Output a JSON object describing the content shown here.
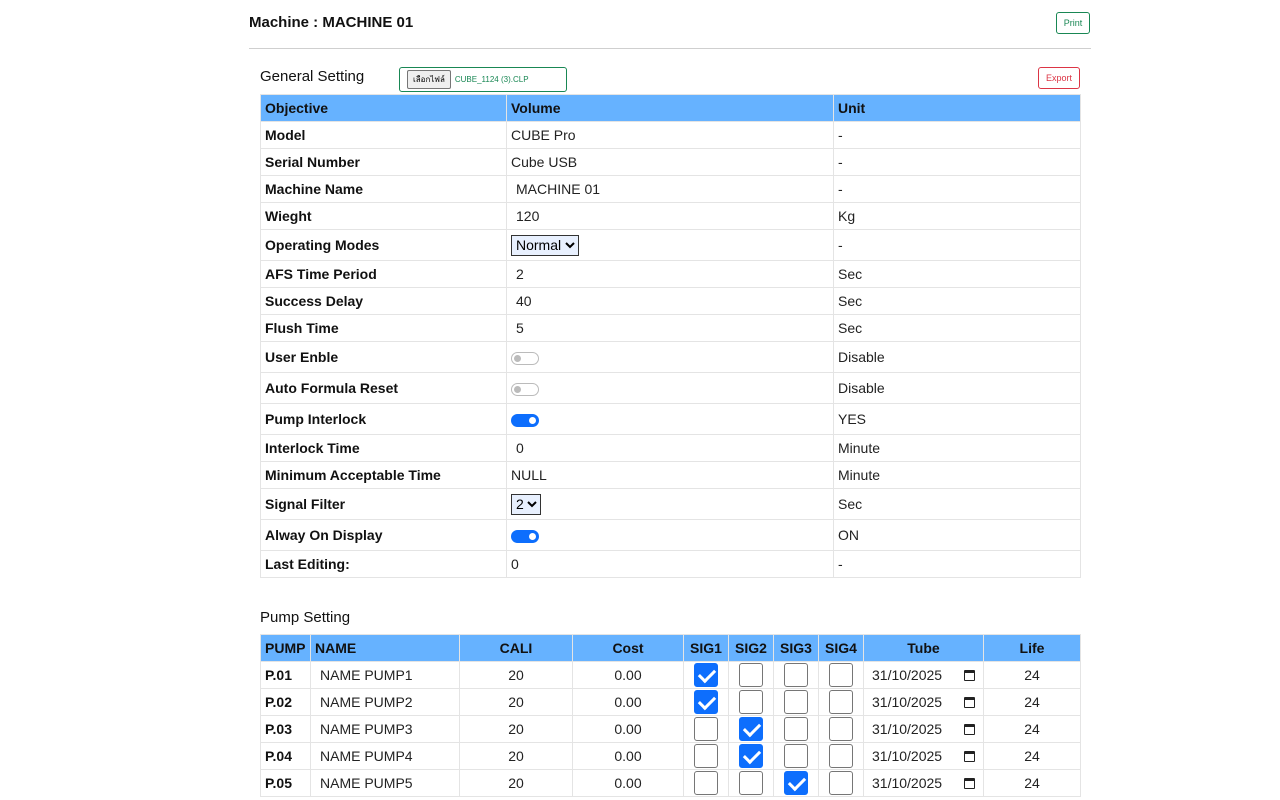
{
  "header": {
    "title": "Machine : MACHINE 01",
    "print_label": "Print"
  },
  "general": {
    "title": "General Setting",
    "file_button": "เลือกไฟล์",
    "file_name": "CUBE_1124 (3).CLP",
    "export_label": "Export",
    "columns": [
      "Objective",
      "Volume",
      "Unit"
    ],
    "rows": [
      {
        "label": "Model",
        "value": "CUBE Pro",
        "unit": "-"
      },
      {
        "label": "Serial Number",
        "value": "Cube USB",
        "unit": "-"
      },
      {
        "label": "Machine Name",
        "value": "MACHINE 01",
        "unit": "-"
      },
      {
        "label": "Wieght",
        "value": "120",
        "unit": "Kg"
      },
      {
        "label": "Operating Modes",
        "value": "Normal",
        "unit": "-"
      },
      {
        "label": "AFS Time Period",
        "value": "2",
        "unit": "Sec"
      },
      {
        "label": "Success Delay",
        "value": "40",
        "unit": "Sec"
      },
      {
        "label": "Flush Time",
        "value": "5",
        "unit": "Sec"
      },
      {
        "label": "User Enble",
        "value": false,
        "unit": "Disable"
      },
      {
        "label": "Auto Formula Reset",
        "value": false,
        "unit": "Disable"
      },
      {
        "label": "Pump Interlock",
        "value": true,
        "unit": "YES"
      },
      {
        "label": "Interlock Time",
        "value": "0",
        "unit": "Minute"
      },
      {
        "label": "Minimum Acceptable Time",
        "value": "NULL",
        "unit": "Minute"
      },
      {
        "label": "Signal Filter",
        "value": "2",
        "unit": "Sec"
      },
      {
        "label": "Alway On Display",
        "value": true,
        "unit": "ON"
      },
      {
        "label": "Last Editing:",
        "value": "0",
        "unit": "-"
      }
    ]
  },
  "pump": {
    "title": "Pump Setting",
    "columns": [
      "PUMP",
      "NAME",
      "CALI",
      "Cost",
      "SIG1",
      "SIG2",
      "SIG3",
      "SIG4",
      "Tube",
      "Life"
    ],
    "rows": [
      {
        "pump": "P.01",
        "name": "NAME PUMP1",
        "cali": "20",
        "cost": "0.00",
        "sig": [
          true,
          false,
          false,
          false
        ],
        "tube": "31/10/2025",
        "life": "24"
      },
      {
        "pump": "P.02",
        "name": "NAME PUMP2",
        "cali": "20",
        "cost": "0.00",
        "sig": [
          true,
          false,
          false,
          false
        ],
        "tube": "31/10/2025",
        "life": "24"
      },
      {
        "pump": "P.03",
        "name": "NAME PUMP3",
        "cali": "20",
        "cost": "0.00",
        "sig": [
          false,
          true,
          false,
          false
        ],
        "tube": "31/10/2025",
        "life": "24"
      },
      {
        "pump": "P.04",
        "name": "NAME PUMP4",
        "cali": "20",
        "cost": "0.00",
        "sig": [
          false,
          true,
          false,
          false
        ],
        "tube": "31/10/2025",
        "life": "24"
      },
      {
        "pump": "P.05",
        "name": "NAME PUMP5",
        "cali": "20",
        "cost": "0.00",
        "sig": [
          false,
          false,
          true,
          false
        ],
        "tube": "31/10/2025",
        "life": "24"
      }
    ]
  },
  "colors": {
    "header_bg": "#66b2ff",
    "accent": "#0d6efd",
    "success": "#198754",
    "danger": "#dc3545"
  }
}
